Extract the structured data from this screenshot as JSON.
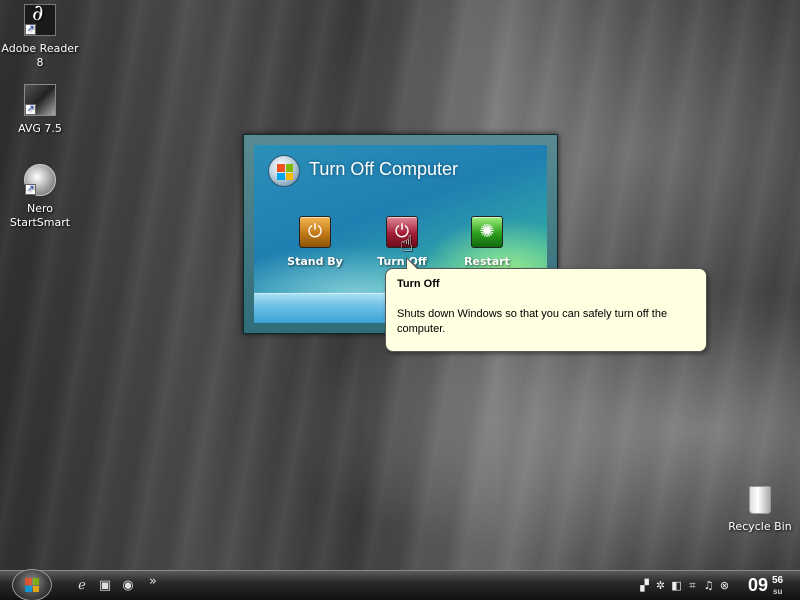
{
  "desktop": {
    "icons": [
      {
        "label": "Adobe Reader 8"
      },
      {
        "label": "AVG 7.5"
      },
      {
        "label": "Nero StartSmart"
      },
      {
        "label": "Recycle Bin"
      }
    ]
  },
  "dialog": {
    "title": "Turn Off Computer",
    "buttons": [
      {
        "label": "Stand By",
        "icon": "power-icon",
        "color": "#c27a17"
      },
      {
        "label": "Turn Off",
        "icon": "power-icon",
        "color": "#a11e35"
      },
      {
        "label": "Restart",
        "icon": "restart-icon",
        "color": "#2e9e1e"
      }
    ]
  },
  "tooltip": {
    "title": "Turn Off",
    "text": "Shuts down Windows so that you can safely turn off the computer."
  },
  "taskbar": {
    "quick_launch": [
      "ie-icon",
      "show-desktop-icon",
      "media-icon"
    ],
    "overflow": "»",
    "clock": {
      "hour": "09",
      "minute": "56",
      "day": "su"
    }
  }
}
